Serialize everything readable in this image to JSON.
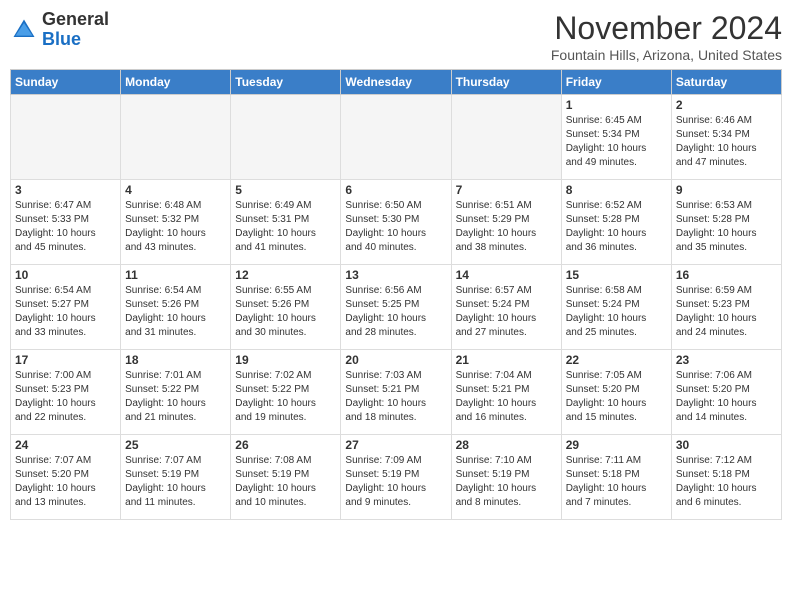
{
  "header": {
    "logo_line1": "General",
    "logo_line2": "Blue",
    "month": "November 2024",
    "location": "Fountain Hills, Arizona, United States"
  },
  "weekdays": [
    "Sunday",
    "Monday",
    "Tuesday",
    "Wednesday",
    "Thursday",
    "Friday",
    "Saturday"
  ],
  "weeks": [
    [
      {
        "day": "",
        "info": ""
      },
      {
        "day": "",
        "info": ""
      },
      {
        "day": "",
        "info": ""
      },
      {
        "day": "",
        "info": ""
      },
      {
        "day": "",
        "info": ""
      },
      {
        "day": "1",
        "info": "Sunrise: 6:45 AM\nSunset: 5:34 PM\nDaylight: 10 hours\nand 49 minutes."
      },
      {
        "day": "2",
        "info": "Sunrise: 6:46 AM\nSunset: 5:34 PM\nDaylight: 10 hours\nand 47 minutes."
      }
    ],
    [
      {
        "day": "3",
        "info": "Sunrise: 6:47 AM\nSunset: 5:33 PM\nDaylight: 10 hours\nand 45 minutes."
      },
      {
        "day": "4",
        "info": "Sunrise: 6:48 AM\nSunset: 5:32 PM\nDaylight: 10 hours\nand 43 minutes."
      },
      {
        "day": "5",
        "info": "Sunrise: 6:49 AM\nSunset: 5:31 PM\nDaylight: 10 hours\nand 41 minutes."
      },
      {
        "day": "6",
        "info": "Sunrise: 6:50 AM\nSunset: 5:30 PM\nDaylight: 10 hours\nand 40 minutes."
      },
      {
        "day": "7",
        "info": "Sunrise: 6:51 AM\nSunset: 5:29 PM\nDaylight: 10 hours\nand 38 minutes."
      },
      {
        "day": "8",
        "info": "Sunrise: 6:52 AM\nSunset: 5:28 PM\nDaylight: 10 hours\nand 36 minutes."
      },
      {
        "day": "9",
        "info": "Sunrise: 6:53 AM\nSunset: 5:28 PM\nDaylight: 10 hours\nand 35 minutes."
      }
    ],
    [
      {
        "day": "10",
        "info": "Sunrise: 6:54 AM\nSunset: 5:27 PM\nDaylight: 10 hours\nand 33 minutes."
      },
      {
        "day": "11",
        "info": "Sunrise: 6:54 AM\nSunset: 5:26 PM\nDaylight: 10 hours\nand 31 minutes."
      },
      {
        "day": "12",
        "info": "Sunrise: 6:55 AM\nSunset: 5:26 PM\nDaylight: 10 hours\nand 30 minutes."
      },
      {
        "day": "13",
        "info": "Sunrise: 6:56 AM\nSunset: 5:25 PM\nDaylight: 10 hours\nand 28 minutes."
      },
      {
        "day": "14",
        "info": "Sunrise: 6:57 AM\nSunset: 5:24 PM\nDaylight: 10 hours\nand 27 minutes."
      },
      {
        "day": "15",
        "info": "Sunrise: 6:58 AM\nSunset: 5:24 PM\nDaylight: 10 hours\nand 25 minutes."
      },
      {
        "day": "16",
        "info": "Sunrise: 6:59 AM\nSunset: 5:23 PM\nDaylight: 10 hours\nand 24 minutes."
      }
    ],
    [
      {
        "day": "17",
        "info": "Sunrise: 7:00 AM\nSunset: 5:23 PM\nDaylight: 10 hours\nand 22 minutes."
      },
      {
        "day": "18",
        "info": "Sunrise: 7:01 AM\nSunset: 5:22 PM\nDaylight: 10 hours\nand 21 minutes."
      },
      {
        "day": "19",
        "info": "Sunrise: 7:02 AM\nSunset: 5:22 PM\nDaylight: 10 hours\nand 19 minutes."
      },
      {
        "day": "20",
        "info": "Sunrise: 7:03 AM\nSunset: 5:21 PM\nDaylight: 10 hours\nand 18 minutes."
      },
      {
        "day": "21",
        "info": "Sunrise: 7:04 AM\nSunset: 5:21 PM\nDaylight: 10 hours\nand 16 minutes."
      },
      {
        "day": "22",
        "info": "Sunrise: 7:05 AM\nSunset: 5:20 PM\nDaylight: 10 hours\nand 15 minutes."
      },
      {
        "day": "23",
        "info": "Sunrise: 7:06 AM\nSunset: 5:20 PM\nDaylight: 10 hours\nand 14 minutes."
      }
    ],
    [
      {
        "day": "24",
        "info": "Sunrise: 7:07 AM\nSunset: 5:20 PM\nDaylight: 10 hours\nand 13 minutes."
      },
      {
        "day": "25",
        "info": "Sunrise: 7:07 AM\nSunset: 5:19 PM\nDaylight: 10 hours\nand 11 minutes."
      },
      {
        "day": "26",
        "info": "Sunrise: 7:08 AM\nSunset: 5:19 PM\nDaylight: 10 hours\nand 10 minutes."
      },
      {
        "day": "27",
        "info": "Sunrise: 7:09 AM\nSunset: 5:19 PM\nDaylight: 10 hours\nand 9 minutes."
      },
      {
        "day": "28",
        "info": "Sunrise: 7:10 AM\nSunset: 5:19 PM\nDaylight: 10 hours\nand 8 minutes."
      },
      {
        "day": "29",
        "info": "Sunrise: 7:11 AM\nSunset: 5:18 PM\nDaylight: 10 hours\nand 7 minutes."
      },
      {
        "day": "30",
        "info": "Sunrise: 7:12 AM\nSunset: 5:18 PM\nDaylight: 10 hours\nand 6 minutes."
      }
    ]
  ]
}
